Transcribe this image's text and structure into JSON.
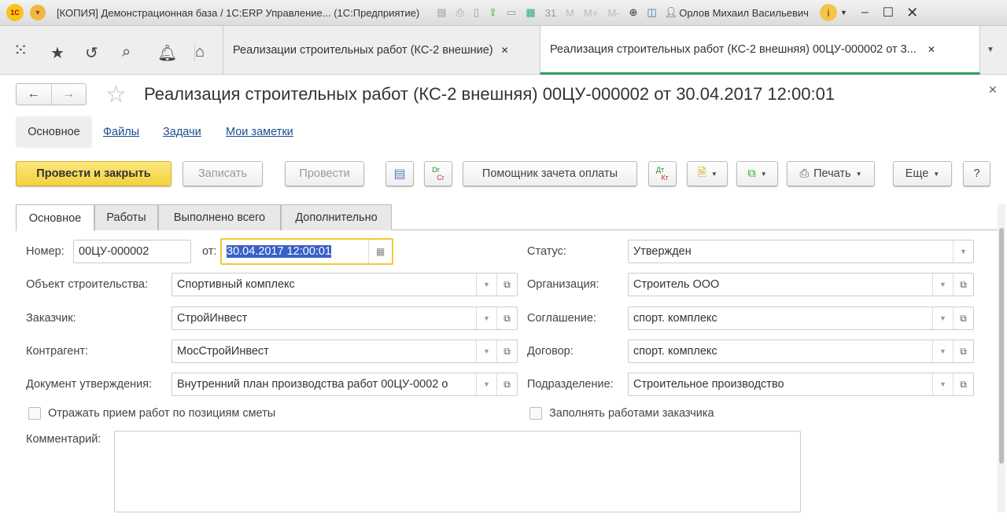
{
  "window": {
    "title": "[КОПИЯ] Демонстрационная база / 1С:ERP Управление... (1С:Предприятие)",
    "user": "Орлов Михаил Васильевич",
    "m_buttons": [
      "M",
      "M+",
      "M-"
    ]
  },
  "open_tabs": [
    {
      "label": "Реализации строительных работ (КС-2 внешние)"
    },
    {
      "label": "Реализация строительных работ (КС-2 внешняя) 00ЦУ-000002 от 3..."
    }
  ],
  "document": {
    "title": "Реализация строительных работ (КС-2 внешняя) 00ЦУ-000002 от 30.04.2017 12:00:01"
  },
  "links": [
    "Основное",
    "Файлы",
    "Задачи",
    "Мои заметки"
  ],
  "toolbar": {
    "post_close": "Провести и закрыть",
    "save": "Записать",
    "post": "Провести",
    "drcr_top": "Dr",
    "drcr_bot": "Cr",
    "helper": "Помощник зачета оплаты",
    "dtkt_top": "Дт",
    "dtkt_bot": "Кт",
    "print": "Печать",
    "more": "Еще",
    "help": "?"
  },
  "form_tabs": [
    "Основное",
    "Работы",
    "Выполнено всего",
    "Дополнительно"
  ],
  "form": {
    "number_label": "Номер:",
    "number": "00ЦУ-000002",
    "date_label": "от:",
    "date": "30.04.2017 12:00:01",
    "left": [
      {
        "label": "Объект строительства:",
        "value": "Спортивный комплекс"
      },
      {
        "label": "Заказчик:",
        "value": "СтройИнвест"
      },
      {
        "label": "Контрагент:",
        "value": "МосСтройИнвест"
      },
      {
        "label": "Документ утверждения:",
        "value": "Внутренний план производства работ 00ЦУ-0002 о"
      }
    ],
    "right": [
      {
        "label": "Статус:",
        "value": "Утвержден"
      },
      {
        "label": "Организация:",
        "value": "Строитель ООО"
      },
      {
        "label": "Соглашение:",
        "value": "спорт. комплекс"
      },
      {
        "label": "Договор:",
        "value": "спорт. комплекс"
      },
      {
        "label": "Подразделение:",
        "value": "Строительное производство"
      }
    ],
    "checkbox1": "Отражать прием работ по позициям сметы",
    "checkbox2": "Заполнять работами заказчика",
    "comment_label": "Комментарий:",
    "comment": ""
  }
}
